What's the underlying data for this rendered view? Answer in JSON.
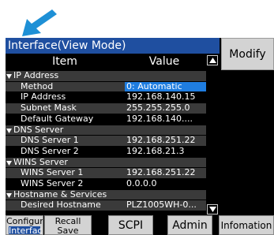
{
  "title": "Interface(View Mode)",
  "modify_label": "Modify",
  "headers": {
    "item": "Item",
    "value": "Value"
  },
  "rows": [
    {
      "type": "group",
      "label": "IP Address",
      "value": ""
    },
    {
      "type": "item",
      "label": "Method",
      "value": "0: Automatic",
      "selected": true
    },
    {
      "type": "item",
      "label": "IP Address",
      "value": "192.168.140.15"
    },
    {
      "type": "item",
      "label": "Subnet Mask",
      "value": "255.255.255.0"
    },
    {
      "type": "item",
      "label": "Default Gateway",
      "value": "192.168.140...."
    },
    {
      "type": "group",
      "label": "DNS Server",
      "value": ""
    },
    {
      "type": "item",
      "label": "DNS Server 1",
      "value": "192.168.251.22"
    },
    {
      "type": "item",
      "label": "DNS Server 2",
      "value": "192.168.21.3"
    },
    {
      "type": "group",
      "label": "WINS Server",
      "value": ""
    },
    {
      "type": "item",
      "label": "WINS Server 1",
      "value": "192.168.251.22"
    },
    {
      "type": "item",
      "label": "WINS Server 2",
      "value": "0.0.0.0"
    },
    {
      "type": "group",
      "label": "Hostname & Services",
      "value": ""
    },
    {
      "type": "item",
      "label": "Desired Hostname",
      "value": "PLZ1005WH-0..."
    }
  ],
  "bottom_buttons": {
    "configure": {
      "line1": "Configure",
      "line2": "Interface"
    },
    "recall": {
      "line1": "Recall",
      "line2": "Save"
    },
    "scpi": "SCPI",
    "admin": "Admin",
    "info": "Infomation"
  },
  "colors": {
    "title_bg": "#1f4fa0",
    "selected_value_bg": "#1f7de0",
    "pointer_arrow": "#1e90d6",
    "row_alt_bg": "#3a3a3a"
  },
  "icons": {
    "pointer": "arrow-pointing-down-right",
    "expand": "triangle-down",
    "scroll_up": "triangle-up",
    "scroll_down": "triangle-down"
  }
}
